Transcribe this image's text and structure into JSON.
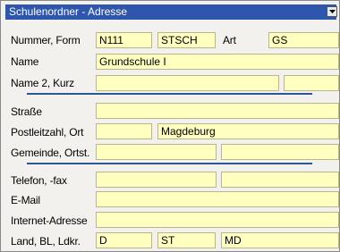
{
  "panel": {
    "title": "Schulenordner - Adresse"
  },
  "rows": {
    "nummer": {
      "label": "Nummer, Form",
      "number": "N111",
      "form": "STSCH",
      "art_label": "Art",
      "art": "GS"
    },
    "name": {
      "label": "Name",
      "value": "Grundschule I"
    },
    "name2": {
      "label": "Name 2, Kurz",
      "value": "",
      "short": ""
    },
    "strasse": {
      "label": "Straße",
      "value": ""
    },
    "plz_ort": {
      "label": "Postleitzahl, Ort",
      "plz": "",
      "ort": "Magdeburg"
    },
    "gemeinde": {
      "label": "Gemeinde, Ortst.",
      "gemeinde": "",
      "ortsteil": ""
    },
    "telefon": {
      "label": "Telefon, -fax",
      "telefon": "",
      "fax": ""
    },
    "email": {
      "label": "E-Mail",
      "value": ""
    },
    "internet": {
      "label": "Internet-Adresse",
      "value": ""
    },
    "land": {
      "label": "Land, BL, Ldkr.",
      "land": "D",
      "bl": "ST",
      "ldkr": "MD"
    }
  },
  "colors": {
    "titlebar": "#2f56ad",
    "field_bg": "#ffffc0",
    "separator": "#2e5594",
    "panel_bg": "#f2f1ed"
  }
}
